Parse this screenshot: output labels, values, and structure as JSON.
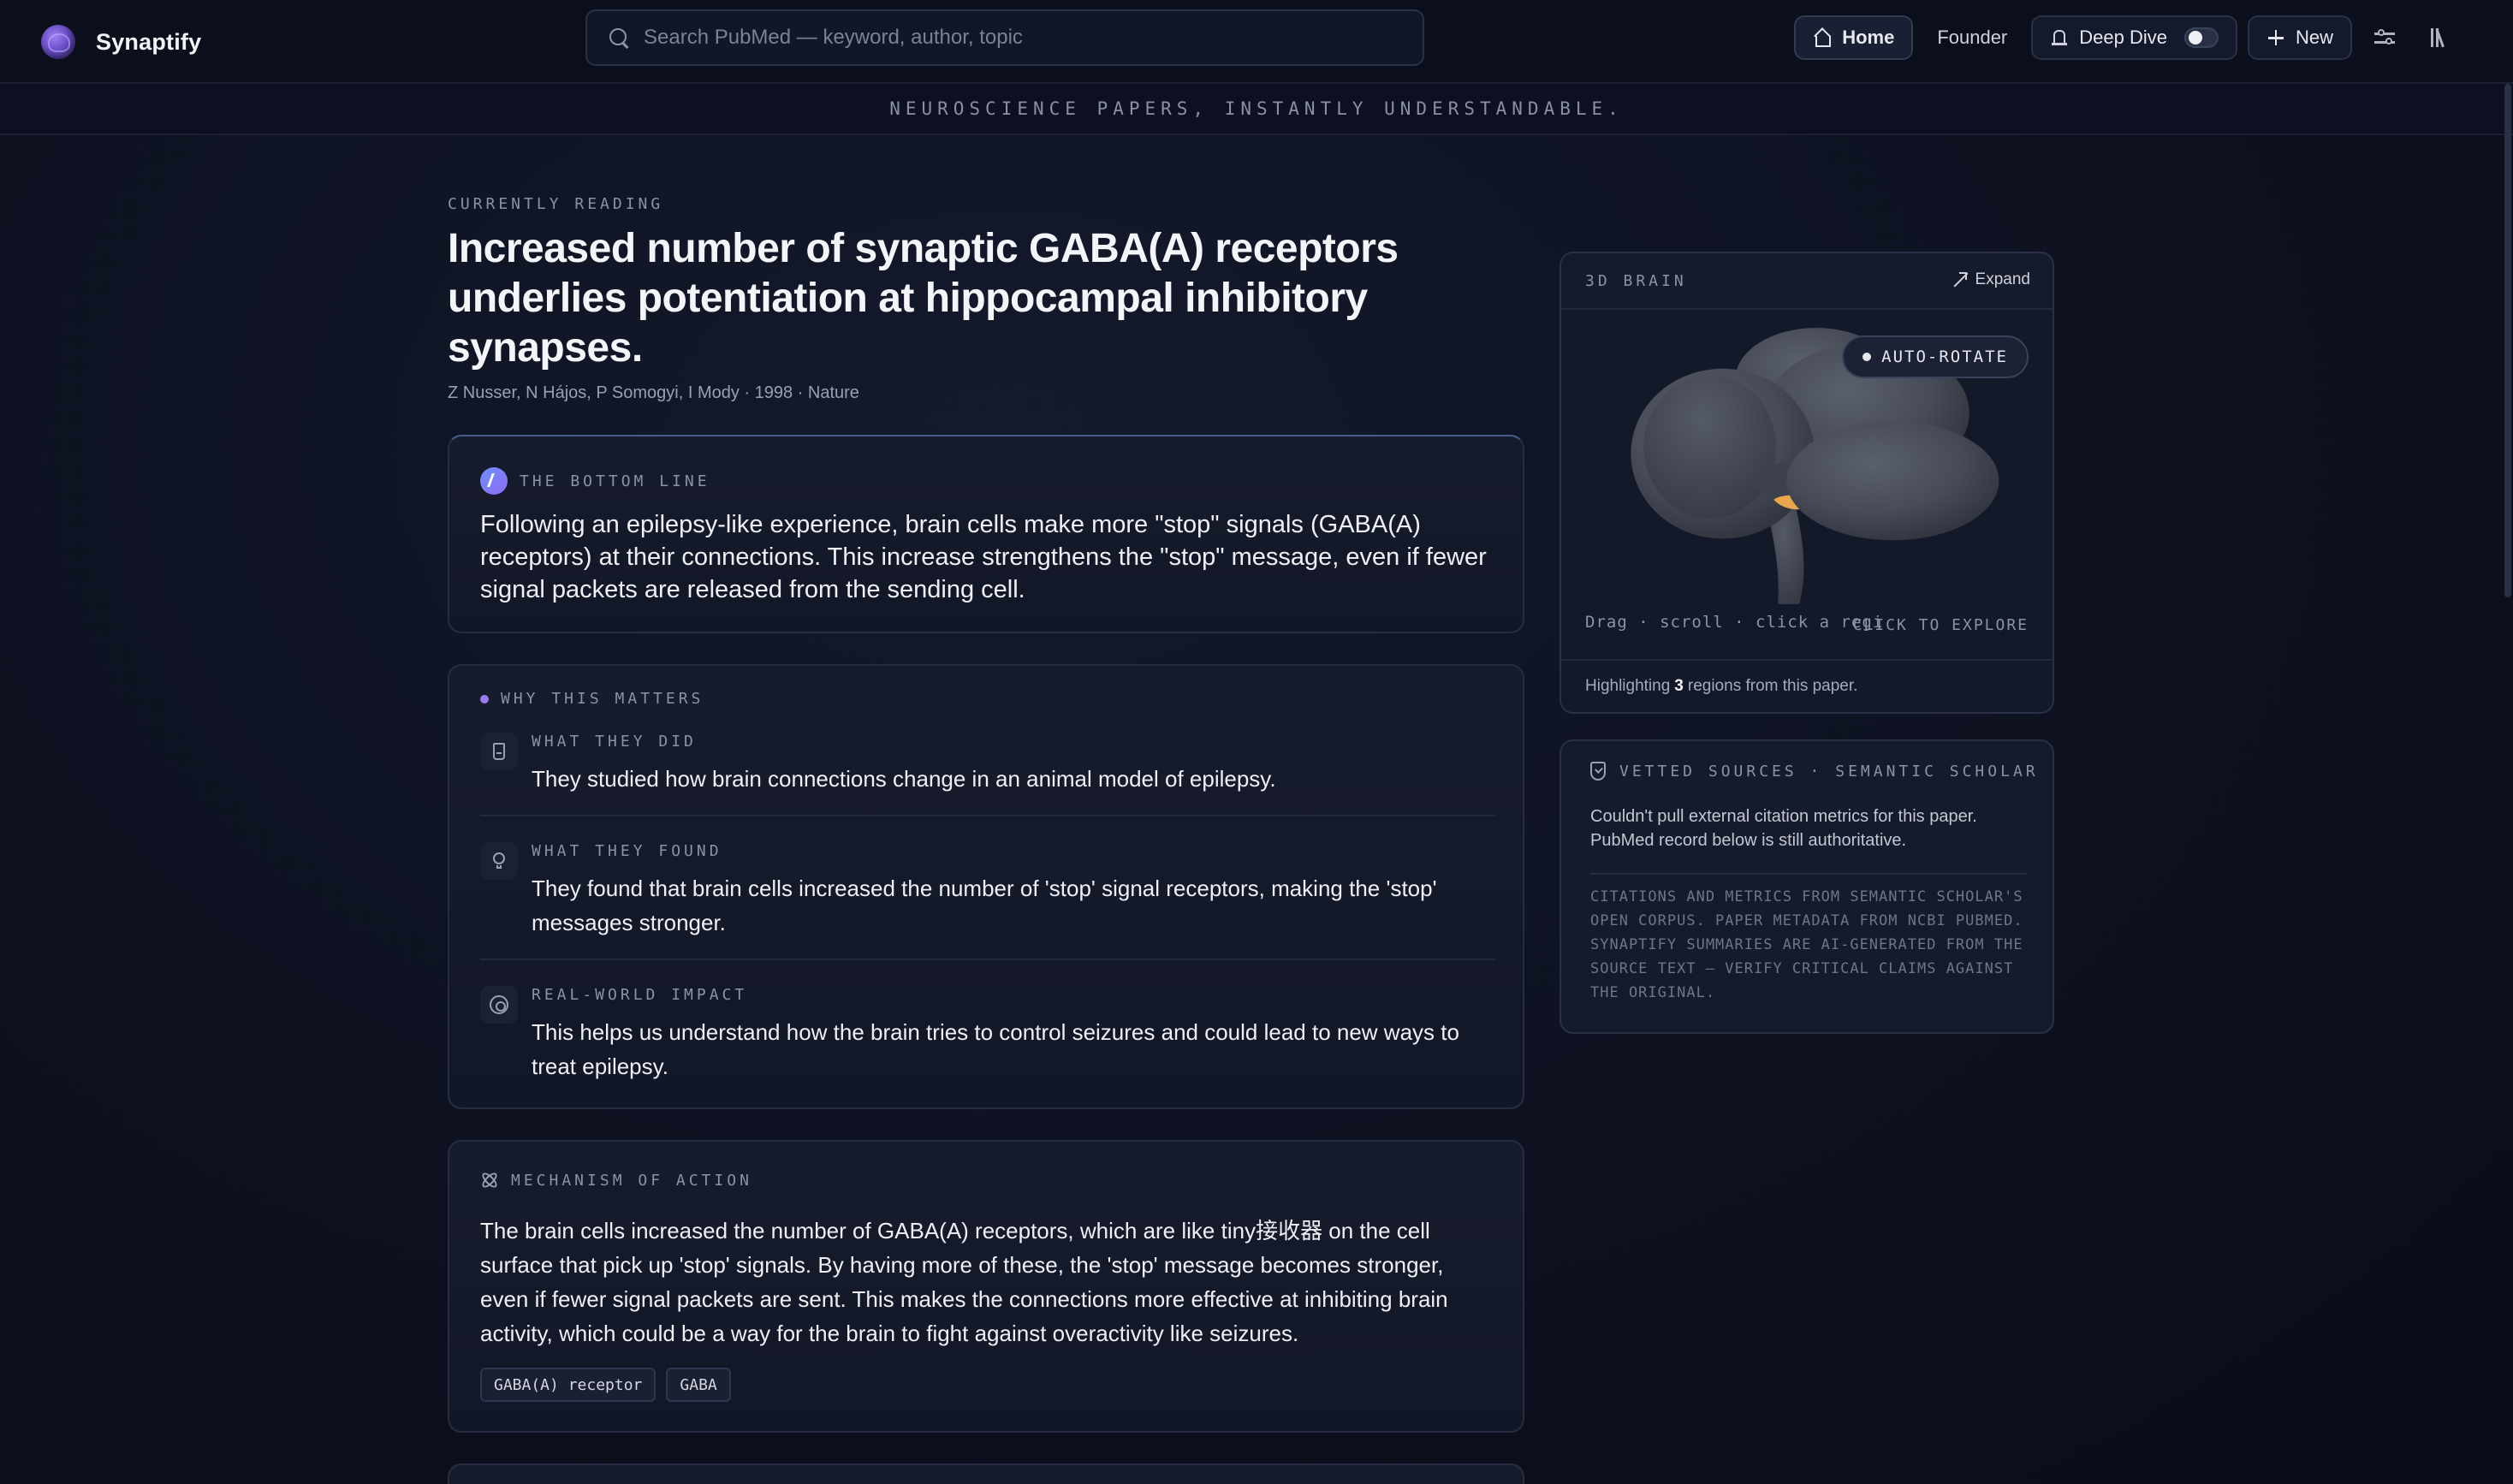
{
  "app": {
    "name": "Synaptify"
  },
  "search": {
    "placeholder": "Search PubMed — keyword, author, topic"
  },
  "nav": {
    "home": "Home",
    "founder": "Founder",
    "deep_dive": "Deep Dive",
    "deep_dive_enabled": false,
    "new": "New"
  },
  "tagline": "NEUROSCIENCE PAPERS, INSTANTLY UNDERSTANDABLE.",
  "paper": {
    "eyebrow": "CURRENTLY READING",
    "title": "Increased number of synaptic GABA(A) receptors underlies potentiation at hippocampal inhibitory synapses.",
    "meta": "Z Nusser, N Hájos, P Somogyi, I Mody · 1998 · Nature"
  },
  "bottom_line": {
    "label": "THE BOTTOM LINE",
    "text": "Following an epilepsy-like experience, brain cells make more \"stop\" signals (GABA(A) receptors) at their connections. This increase strengthens the \"stop\" message, even if fewer signal packets are released from the sending cell."
  },
  "why": {
    "label": "WHY THIS MATTERS",
    "items": [
      {
        "icon": "flask-icon",
        "label": "WHAT THEY DID",
        "text": "They studied how brain connections change in an animal model of epilepsy."
      },
      {
        "icon": "lightbulb-icon",
        "label": "WHAT THEY FOUND",
        "text": "They found that brain cells increased the number of 'stop' signal receptors, making the 'stop' messages stronger."
      },
      {
        "icon": "target-icon",
        "label": "REAL-WORLD IMPACT",
        "text": "This helps us understand how the brain tries to control seizures and could lead to new ways to treat epilepsy."
      }
    ]
  },
  "mechanism": {
    "label": "MECHANISM OF ACTION",
    "text": "The brain cells increased the number of GABA(A) receptors, which are like tiny接收器 on the cell surface that pick up 'stop' signals. By having more of these, the 'stop' message becomes stronger, even if fewer signal packets are sent. This makes the connections more effective at inhibiting brain activity, which could be a way for the brain to fight against overactivity like seizures.",
    "tags": [
      "GABA(A) receptor",
      "GABA"
    ]
  },
  "brain": {
    "label": "3D BRAIN",
    "expand": "Expand",
    "auto_rotate": "AUTO-ROTATE",
    "hint": "Drag · scroll · click a regi",
    "explore": "CLICK TO EXPLORE",
    "foot_prefix": "Highlighting",
    "region_count": "3",
    "foot_suffix": "regions from this paper.",
    "colors": {
      "tissue": "#4a4f5c",
      "highlight": "#e9a64a"
    }
  },
  "vetted": {
    "label": "VETTED SOURCES · SEMANTIC SCHOLAR",
    "message": "Couldn't pull external citation metrics for this paper. PubMed record below is still authoritative.",
    "note": "Citations and metrics from Semantic Scholar's open corpus. Paper metadata from NCBI PubMed. Synaptify summaries are AI-generated from the source text — verify critical claims against the original."
  }
}
